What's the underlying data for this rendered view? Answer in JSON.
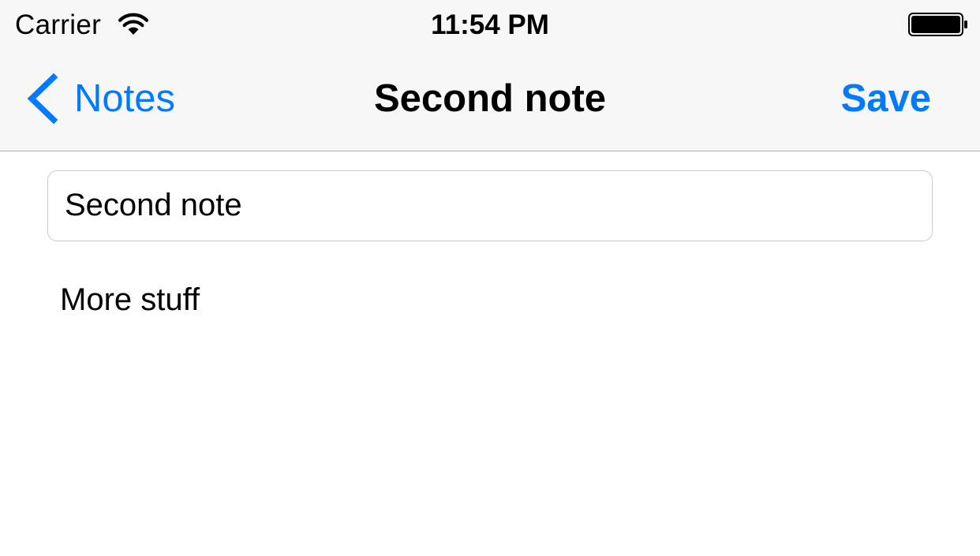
{
  "status_bar": {
    "carrier": "Carrier",
    "time": "11:54 PM",
    "wifi_icon": "wifi-icon",
    "battery_icon": "battery-full-icon",
    "battery_level": 1.0
  },
  "nav_bar": {
    "back_label": "Notes",
    "back_icon": "chevron-left-icon",
    "title": "Second note",
    "save_label": "Save"
  },
  "editor": {
    "title_value": "Second note",
    "body_value": "More stuff"
  },
  "colors": {
    "accent": "#007aff",
    "bar_background": "#f7f7f7",
    "separator": "#b2b2b2"
  }
}
